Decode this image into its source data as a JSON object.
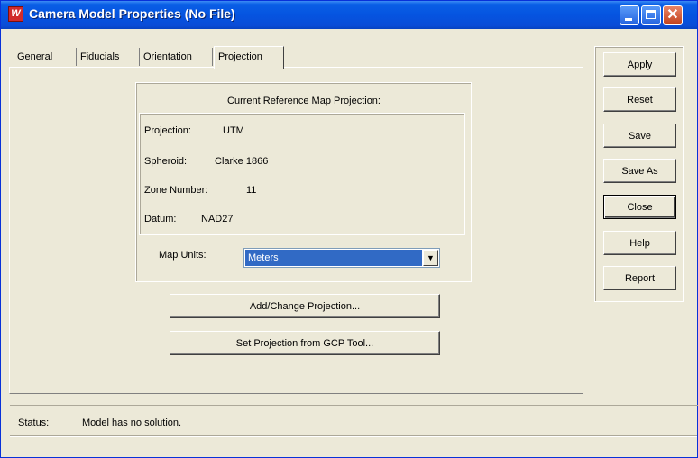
{
  "window": {
    "title": "Camera Model Properties (No File)",
    "icon": "app-icon",
    "controls": [
      "minimize-icon",
      "maximize-icon",
      "close-icon"
    ]
  },
  "tabs": [
    {
      "label": "General",
      "active": false
    },
    {
      "label": "Fiducials",
      "active": false
    },
    {
      "label": "Orientation",
      "active": false
    },
    {
      "label": "Projection",
      "active": true
    }
  ],
  "projection_panel": {
    "group_title": "Current Reference Map Projection:",
    "projection_label": "Projection:",
    "projection_value": "UTM",
    "spheroid_label": "Spheroid:",
    "spheroid_value": "Clarke 1866",
    "zone_label": "Zone Number:",
    "zone_value": "11",
    "datum_label": "Datum:",
    "datum_value": "NAD27",
    "map_units_label": "Map Units:",
    "map_units_value": "Meters",
    "add_change_button": "Add/Change Projection...",
    "set_from_gcp_button": "Set Projection from GCP Tool..."
  },
  "side_buttons": {
    "apply": "Apply",
    "reset": "Reset",
    "save": "Save",
    "save_as": "Save As",
    "close": "Close",
    "help": "Help",
    "report": "Report"
  },
  "status": {
    "label": "Status:",
    "text": "Model has no solution."
  },
  "colors": {
    "titlebar": "#0554e0",
    "window_bg": "#ece9d8",
    "selection": "#316ac5"
  }
}
